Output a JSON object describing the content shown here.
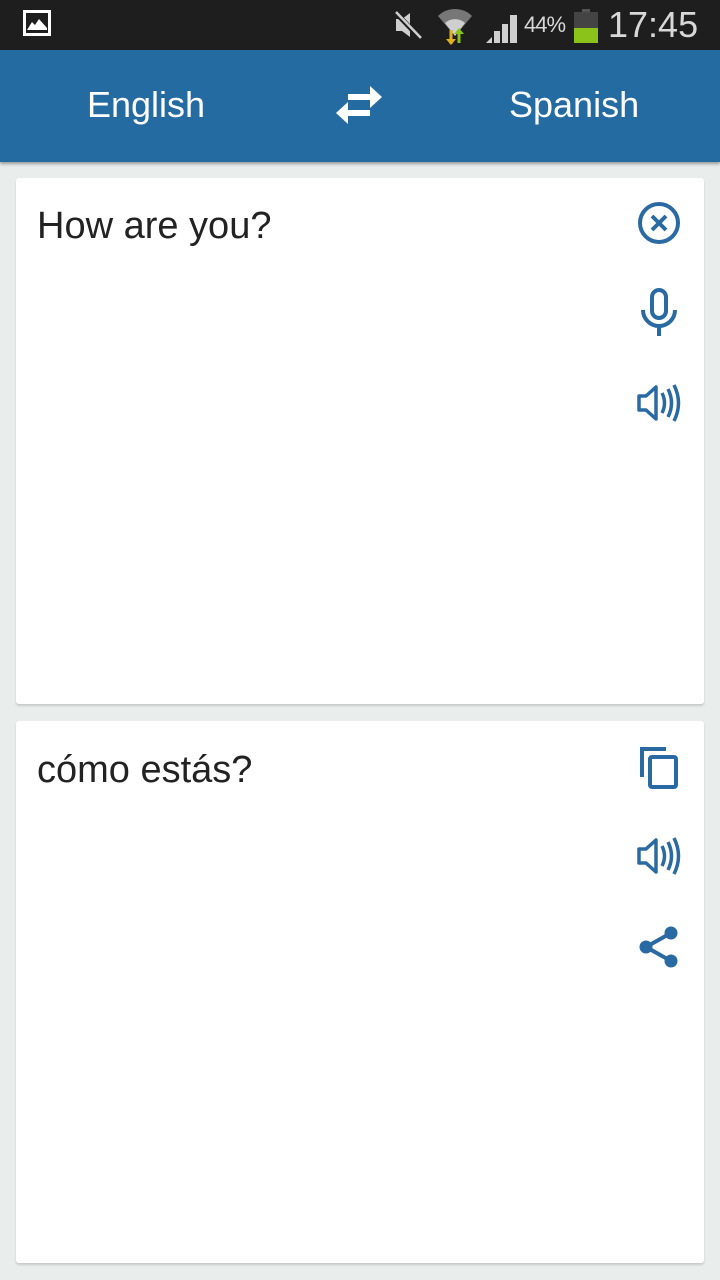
{
  "status_bar": {
    "battery_percent": "44%",
    "time": "17:45",
    "icons": [
      "gallery-notification-icon",
      "mute-icon",
      "wifi-icon",
      "signal-icon",
      "battery-icon"
    ]
  },
  "app_bar": {
    "source_language": "English",
    "target_language": "Spanish",
    "swap_icon": "swap-languages-icon",
    "color": "#246ba1"
  },
  "source_card": {
    "text": "How are you?",
    "actions": [
      "clear-icon",
      "microphone-icon",
      "speaker-icon"
    ]
  },
  "result_card": {
    "text": "cómo estás?",
    "actions": [
      "copy-icon",
      "speaker-icon",
      "share-icon"
    ]
  },
  "colors": {
    "accent": "#246ba1",
    "icon": "#2a6aa3",
    "background": "#e9edec"
  }
}
